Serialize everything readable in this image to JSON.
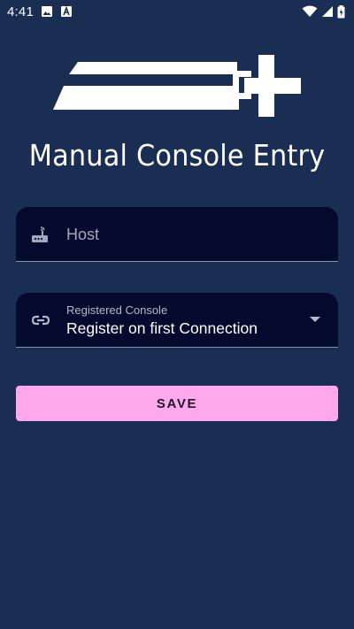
{
  "status_bar": {
    "time": "4:41",
    "icons": [
      "image-notification-icon",
      "a-notification-icon",
      "wifi-icon",
      "signal-icon",
      "battery-charging-icon"
    ]
  },
  "app": {
    "title": "Manual Console Entry",
    "logo": "app-logo"
  },
  "host_field": {
    "placeholder": "Host",
    "icon": "router-icon"
  },
  "console_field": {
    "label": "Registered Console",
    "value": "Register on first Connection",
    "icon": "link-icon"
  },
  "save_button": {
    "label": "SAVE"
  },
  "colors": {
    "background": "#1a2d52",
    "field_background": "#040a2e",
    "button": "#ffa8ec"
  }
}
